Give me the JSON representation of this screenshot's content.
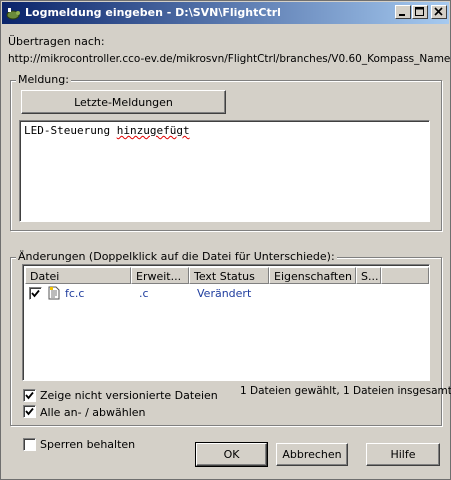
{
  "window": {
    "title": "Logmeldung eingeben - D:\\SVN\\FlightCtrl"
  },
  "header": {
    "commit_to_label": "Übertragen nach:",
    "commit_url": "http://mikrocontroller.cco-ev.de/mikrosvn/FlightCtrl/branches/V0.60_Kompass_Name"
  },
  "message_group": {
    "label": "Meldung:",
    "recent_button": "Letzte-Meldungen",
    "message_word1": "LED-Steuerung",
    "message_word2": "hinzugefügt"
  },
  "changes_group": {
    "label": "Änderungen (Doppelklick auf die Datei für Unterschiede):",
    "columns": [
      "Datei",
      "Erweit...",
      "Text Status",
      "Eigenschaften",
      "S..."
    ],
    "rows": [
      {
        "checked": true,
        "file": "fc.c",
        "extension": ".c",
        "text_status": "Verändert",
        "properties": "",
        "s": ""
      }
    ],
    "show_unversioned_label": "Zeige nicht versionierte Dateien",
    "select_all_label": "Alle an- / abwählen",
    "summary": "1 Dateien gewählt, 1 Dateien insgesamt"
  },
  "footer": {
    "keep_locks_label": "Sperren behalten",
    "ok_button": "OK",
    "cancel_button": "Abbrechen",
    "help_button": "Hilfe"
  },
  "icons": {
    "app": "tortoisesvn-icon",
    "file": "text-file-icon"
  }
}
